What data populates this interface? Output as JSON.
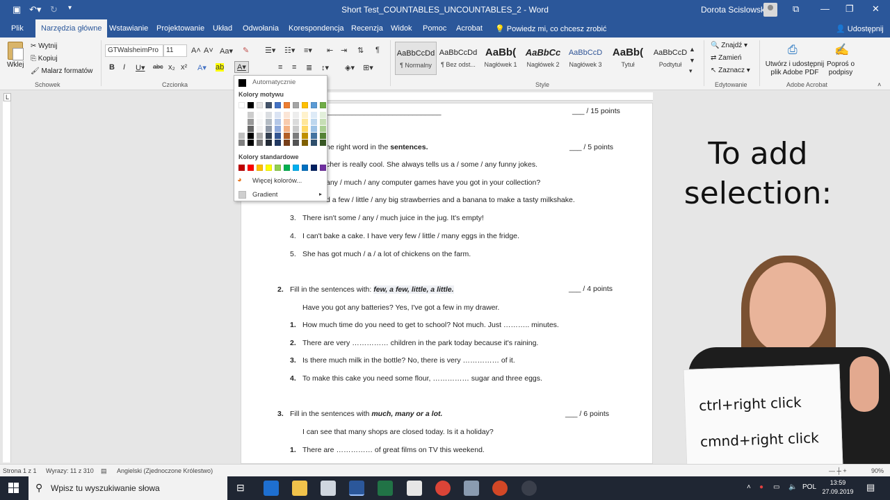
{
  "window": {
    "title": "Short Test_COUNTABLES_UNCOUNTABLES_2  -  Word",
    "user": "Dorota Scislowska"
  },
  "tabs": [
    "Plik",
    "Narzędzia główne",
    "Wstawianie",
    "Projektowanie",
    "Układ",
    "Odwołania",
    "Korespondencja",
    "Recenzja",
    "Widok",
    "Pomoc",
    "Acrobat"
  ],
  "tell_me": "Powiedz mi, co chcesz zrobić",
  "share": "Udostępnij",
  "ribbon": {
    "clipboard": {
      "paste": "Wklej",
      "cut": "Wytnij",
      "copy": "Kopiuj",
      "painter": "Malarz formatów",
      "label": "Schowek"
    },
    "font": {
      "name": "GTWalsheimPro",
      "size": "11",
      "label": "Czcionka"
    },
    "styles": {
      "label": "Style",
      "items": [
        {
          "sample": "AaBbCcDd",
          "name": "¶ Normalny"
        },
        {
          "sample": "AaBbCcDd",
          "name": "¶ Bez odst..."
        },
        {
          "sample": "AaBb(",
          "name": "Nagłówek 1"
        },
        {
          "sample": "AaBbCc",
          "name": "Nagłówek 2"
        },
        {
          "sample": "AaBbCcD",
          "name": "Nagłówek 3"
        },
        {
          "sample": "AaBb(",
          "name": "Tytuł"
        },
        {
          "sample": "AaBbCcD",
          "name": "Podtytuł"
        }
      ]
    },
    "editing": {
      "find": "Znajdź",
      "replace": "Zamień",
      "select": "Zaznacz",
      "label": "Edytowanie"
    },
    "acrobat": {
      "create": "Utwórz i udostępnij plik Adobe PDF",
      "request": "Poproś o podpisy",
      "label": "Adobe Acrobat"
    }
  },
  "color_menu": {
    "automatic": "Automatycznie",
    "theme_label": "Kolory motywu",
    "standard_label": "Kolory standardowe",
    "more": "Więcej kolorów...",
    "gradient": "Gradient",
    "theme_colors": [
      "#ffffff",
      "#000000",
      "#e7e6e6",
      "#44546a",
      "#4472c4",
      "#ed7d31",
      "#a5a5a5",
      "#ffc000",
      "#5b9bd5",
      "#70ad47"
    ],
    "standard_colors": [
      "#c00000",
      "#ff0000",
      "#ffc000",
      "#ffff00",
      "#92d050",
      "#00b050",
      "#00b0f0",
      "#0070c0",
      "#002060",
      "#7030a0"
    ]
  },
  "document": {
    "header_line": "____________________________",
    "total_points": "___ / 15 points",
    "s1_points": "___ / 5 points",
    "s1_instruction_a": "he right word in the ",
    "s1_instruction_b": "sentences.",
    "s1_example": "cher is really cool. She always tells us a / some / any  funny jokes.",
    "s1_q1": "any / much / any computer games have you got in your collection?",
    "s1_q2": "d  a few / little / any big strawberries and a banana to make a tasty milkshake.",
    "s1_q3": "There isn't  some / any / much juice in the jug. It's empty!",
    "s1_q4": "I can't bake a cake. I have very  few / little / many eggs in the fridge.",
    "s1_q5": "She has got  much / a / a lot of chickens on the farm.",
    "s2_num": "2.",
    "s2_instruction": "Fill in the sentences with: ",
    "s2_words": "few, a few, little, a little.",
    "s2_points": "___ / 4 points",
    "s2_example": "Have you got any batteries? Yes, I've got  a few  in my drawer.",
    "s2_q1": "How much time do you need to get to school?  Not much. Just ……….. minutes.",
    "s2_q2": "There are very …………… children in the park today because it's raining.",
    "s2_q3": "Is there much milk in the bottle? No, there is very …………… of it.",
    "s2_q4": "To make this cake you need some flour, …………… sugar and three eggs.",
    "s3_num": "3.",
    "s3_instruction": "Fill in the sentences with ",
    "s3_words": "much, many  or  a lot.",
    "s3_points": "___ / 6 points",
    "s3_example": "I can see that  many shops are closed today. Is it a holiday?",
    "s3_q1": "There are …………… of great films on TV this weekend.",
    "q_nums": [
      "1.",
      "2.",
      "3.",
      "4.",
      "5."
    ]
  },
  "overlay": {
    "headline": [
      "To add",
      "selection:"
    ],
    "sign_lines": [
      "ctrl+right click",
      "cmnd+right click"
    ]
  },
  "status": {
    "page": "Strona 1 z 1",
    "words": "Wyrazy: 11 z 310",
    "language": "Angielski (Zjednoczone Królestwo)",
    "zoom": "90%"
  },
  "taskbar": {
    "search_placeholder": "Wpisz tu wyszukiwanie słowa",
    "time": "13:59",
    "date": "27.09.2019",
    "lang": "POL"
  }
}
